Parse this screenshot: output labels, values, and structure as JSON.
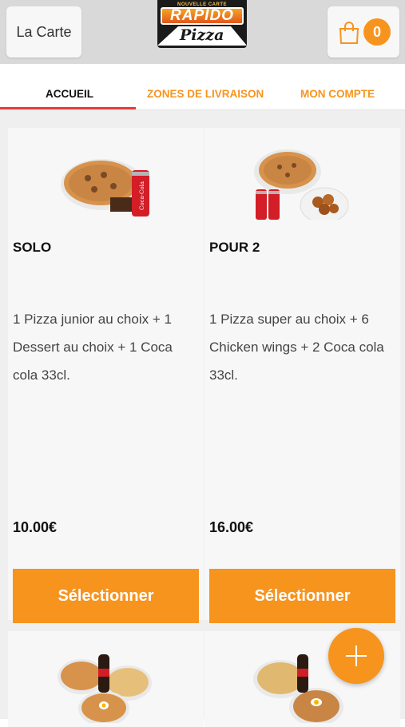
{
  "header": {
    "menu_label": "La Carte",
    "cart_count": "0",
    "logo": {
      "top_text": "NOUVELLE CARTE",
      "main_text": "RAPIDO",
      "sub_text": "Pizza"
    }
  },
  "tabs": [
    {
      "label": "ACCUEIL",
      "active": true
    },
    {
      "label": "ZONES DE LIVRAISON",
      "active": false
    },
    {
      "label": "MON COMPTE",
      "active": false
    }
  ],
  "products": [
    {
      "title": "SOLO",
      "description": "1 Pizza junior au choix  + 1 Dessert au choix  + 1 Coca cola 33cl.",
      "price": "10.00€",
      "button_label": "Sélectionner"
    },
    {
      "title": "POUR 2",
      "description": "1 Pizza super au choix  + 6 Chicken wings  + 2 Coca cola 33cl.",
      "price": "16.00€",
      "button_label": "Sélectionner"
    }
  ],
  "colors": {
    "accent": "#f7941e",
    "tab_underline": "#e83a3a",
    "header_bg": "#d9d9d9"
  },
  "icons": {
    "cart": "shopping-bag-icon",
    "fab": "plus-icon"
  }
}
